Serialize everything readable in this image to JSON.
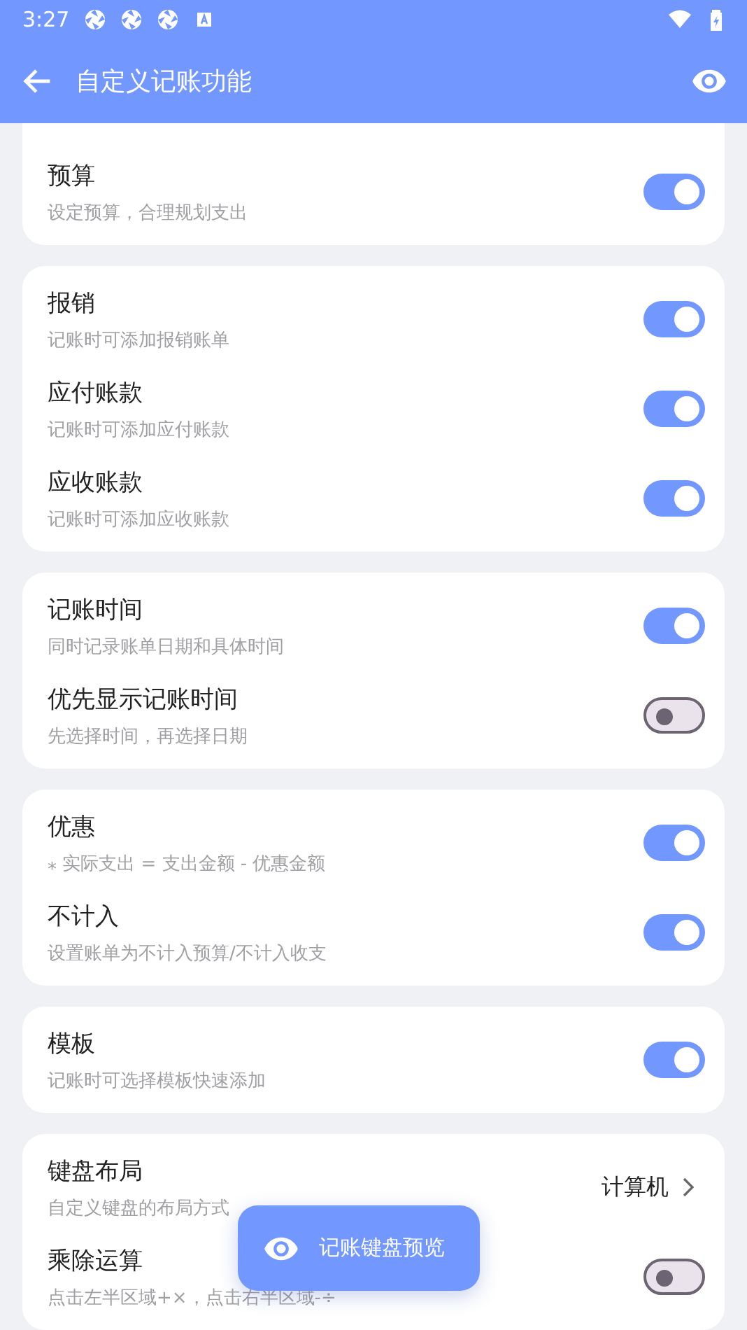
{
  "status_bar": {
    "time": "3:27"
  },
  "app_bar": {
    "title": "自定义记账功能"
  },
  "cards": [
    {
      "clipped_top": true,
      "rows": [
        {
          "kind": "toggle",
          "title": "预算",
          "subtitle": "设定预算，合理规划支出",
          "on": true
        }
      ]
    },
    {
      "clipped_top": false,
      "rows": [
        {
          "kind": "toggle",
          "title": "报销",
          "subtitle": "记账时可添加报销账单",
          "on": true
        },
        {
          "kind": "toggle",
          "title": "应付账款",
          "subtitle": "记账时可添加应付账款",
          "on": true
        },
        {
          "kind": "toggle",
          "title": "应收账款",
          "subtitle": "记账时可添加应收账款",
          "on": true
        }
      ]
    },
    {
      "clipped_top": false,
      "rows": [
        {
          "kind": "toggle",
          "title": "记账时间",
          "subtitle": "同时记录账单日期和具体时间",
          "on": true
        },
        {
          "kind": "toggle",
          "title": "优先显示记账时间",
          "subtitle": "先选择时间，再选择日期",
          "on": false
        }
      ]
    },
    {
      "clipped_top": false,
      "rows": [
        {
          "kind": "toggle",
          "title": "优惠",
          "subtitle": "⁎ 实际支出 = 支出金额 - 优惠金额",
          "on": true
        },
        {
          "kind": "toggle",
          "title": "不计入",
          "subtitle": "设置账单为不计入预算/不计入收支",
          "on": true
        }
      ]
    },
    {
      "clipped_top": false,
      "rows": [
        {
          "kind": "toggle",
          "title": "模板",
          "subtitle": "记账时可选择模板快速添加",
          "on": true
        }
      ]
    },
    {
      "clipped_top": false,
      "rows": [
        {
          "kind": "choice",
          "title": "键盘布局",
          "subtitle": "自定义键盘的布局方式",
          "value": "计算机"
        },
        {
          "kind": "toggle",
          "title": "乘除运算",
          "subtitle": "点击左半区域+×，点击右半区域-÷",
          "on": false
        }
      ]
    }
  ],
  "floating_button": {
    "label": "记账键盘预览"
  }
}
